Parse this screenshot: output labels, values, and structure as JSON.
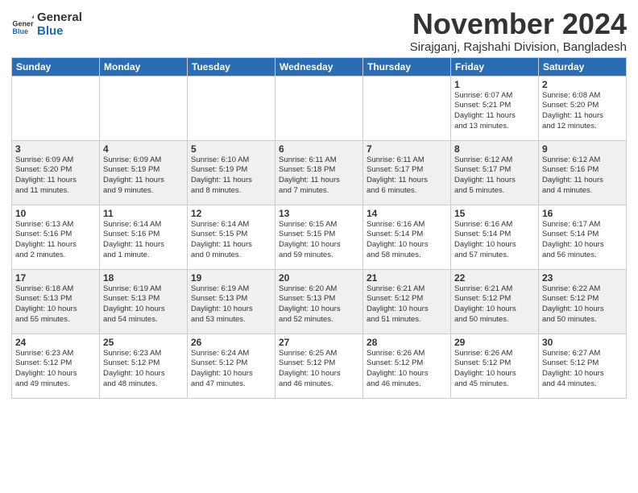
{
  "logo": {
    "line1": "General",
    "line2": "Blue"
  },
  "title": "November 2024",
  "location": "Sirajganj, Rajshahi Division, Bangladesh",
  "days_of_week": [
    "Sunday",
    "Monday",
    "Tuesday",
    "Wednesday",
    "Thursday",
    "Friday",
    "Saturday"
  ],
  "weeks": [
    [
      {
        "day": "",
        "info": ""
      },
      {
        "day": "",
        "info": ""
      },
      {
        "day": "",
        "info": ""
      },
      {
        "day": "",
        "info": ""
      },
      {
        "day": "",
        "info": ""
      },
      {
        "day": "1",
        "info": "Sunrise: 6:07 AM\nSunset: 5:21 PM\nDaylight: 11 hours\nand 13 minutes."
      },
      {
        "day": "2",
        "info": "Sunrise: 6:08 AM\nSunset: 5:20 PM\nDaylight: 11 hours\nand 12 minutes."
      }
    ],
    [
      {
        "day": "3",
        "info": "Sunrise: 6:09 AM\nSunset: 5:20 PM\nDaylight: 11 hours\nand 11 minutes."
      },
      {
        "day": "4",
        "info": "Sunrise: 6:09 AM\nSunset: 5:19 PM\nDaylight: 11 hours\nand 9 minutes."
      },
      {
        "day": "5",
        "info": "Sunrise: 6:10 AM\nSunset: 5:19 PM\nDaylight: 11 hours\nand 8 minutes."
      },
      {
        "day": "6",
        "info": "Sunrise: 6:11 AM\nSunset: 5:18 PM\nDaylight: 11 hours\nand 7 minutes."
      },
      {
        "day": "7",
        "info": "Sunrise: 6:11 AM\nSunset: 5:17 PM\nDaylight: 11 hours\nand 6 minutes."
      },
      {
        "day": "8",
        "info": "Sunrise: 6:12 AM\nSunset: 5:17 PM\nDaylight: 11 hours\nand 5 minutes."
      },
      {
        "day": "9",
        "info": "Sunrise: 6:12 AM\nSunset: 5:16 PM\nDaylight: 11 hours\nand 4 minutes."
      }
    ],
    [
      {
        "day": "10",
        "info": "Sunrise: 6:13 AM\nSunset: 5:16 PM\nDaylight: 11 hours\nand 2 minutes."
      },
      {
        "day": "11",
        "info": "Sunrise: 6:14 AM\nSunset: 5:16 PM\nDaylight: 11 hours\nand 1 minute."
      },
      {
        "day": "12",
        "info": "Sunrise: 6:14 AM\nSunset: 5:15 PM\nDaylight: 11 hours\nand 0 minutes."
      },
      {
        "day": "13",
        "info": "Sunrise: 6:15 AM\nSunset: 5:15 PM\nDaylight: 10 hours\nand 59 minutes."
      },
      {
        "day": "14",
        "info": "Sunrise: 6:16 AM\nSunset: 5:14 PM\nDaylight: 10 hours\nand 58 minutes."
      },
      {
        "day": "15",
        "info": "Sunrise: 6:16 AM\nSunset: 5:14 PM\nDaylight: 10 hours\nand 57 minutes."
      },
      {
        "day": "16",
        "info": "Sunrise: 6:17 AM\nSunset: 5:14 PM\nDaylight: 10 hours\nand 56 minutes."
      }
    ],
    [
      {
        "day": "17",
        "info": "Sunrise: 6:18 AM\nSunset: 5:13 PM\nDaylight: 10 hours\nand 55 minutes."
      },
      {
        "day": "18",
        "info": "Sunrise: 6:19 AM\nSunset: 5:13 PM\nDaylight: 10 hours\nand 54 minutes."
      },
      {
        "day": "19",
        "info": "Sunrise: 6:19 AM\nSunset: 5:13 PM\nDaylight: 10 hours\nand 53 minutes."
      },
      {
        "day": "20",
        "info": "Sunrise: 6:20 AM\nSunset: 5:13 PM\nDaylight: 10 hours\nand 52 minutes."
      },
      {
        "day": "21",
        "info": "Sunrise: 6:21 AM\nSunset: 5:12 PM\nDaylight: 10 hours\nand 51 minutes."
      },
      {
        "day": "22",
        "info": "Sunrise: 6:21 AM\nSunset: 5:12 PM\nDaylight: 10 hours\nand 50 minutes."
      },
      {
        "day": "23",
        "info": "Sunrise: 6:22 AM\nSunset: 5:12 PM\nDaylight: 10 hours\nand 50 minutes."
      }
    ],
    [
      {
        "day": "24",
        "info": "Sunrise: 6:23 AM\nSunset: 5:12 PM\nDaylight: 10 hours\nand 49 minutes."
      },
      {
        "day": "25",
        "info": "Sunrise: 6:23 AM\nSunset: 5:12 PM\nDaylight: 10 hours\nand 48 minutes."
      },
      {
        "day": "26",
        "info": "Sunrise: 6:24 AM\nSunset: 5:12 PM\nDaylight: 10 hours\nand 47 minutes."
      },
      {
        "day": "27",
        "info": "Sunrise: 6:25 AM\nSunset: 5:12 PM\nDaylight: 10 hours\nand 46 minutes."
      },
      {
        "day": "28",
        "info": "Sunrise: 6:26 AM\nSunset: 5:12 PM\nDaylight: 10 hours\nand 46 minutes."
      },
      {
        "day": "29",
        "info": "Sunrise: 6:26 AM\nSunset: 5:12 PM\nDaylight: 10 hours\nand 45 minutes."
      },
      {
        "day": "30",
        "info": "Sunrise: 6:27 AM\nSunset: 5:12 PM\nDaylight: 10 hours\nand 44 minutes."
      }
    ]
  ]
}
